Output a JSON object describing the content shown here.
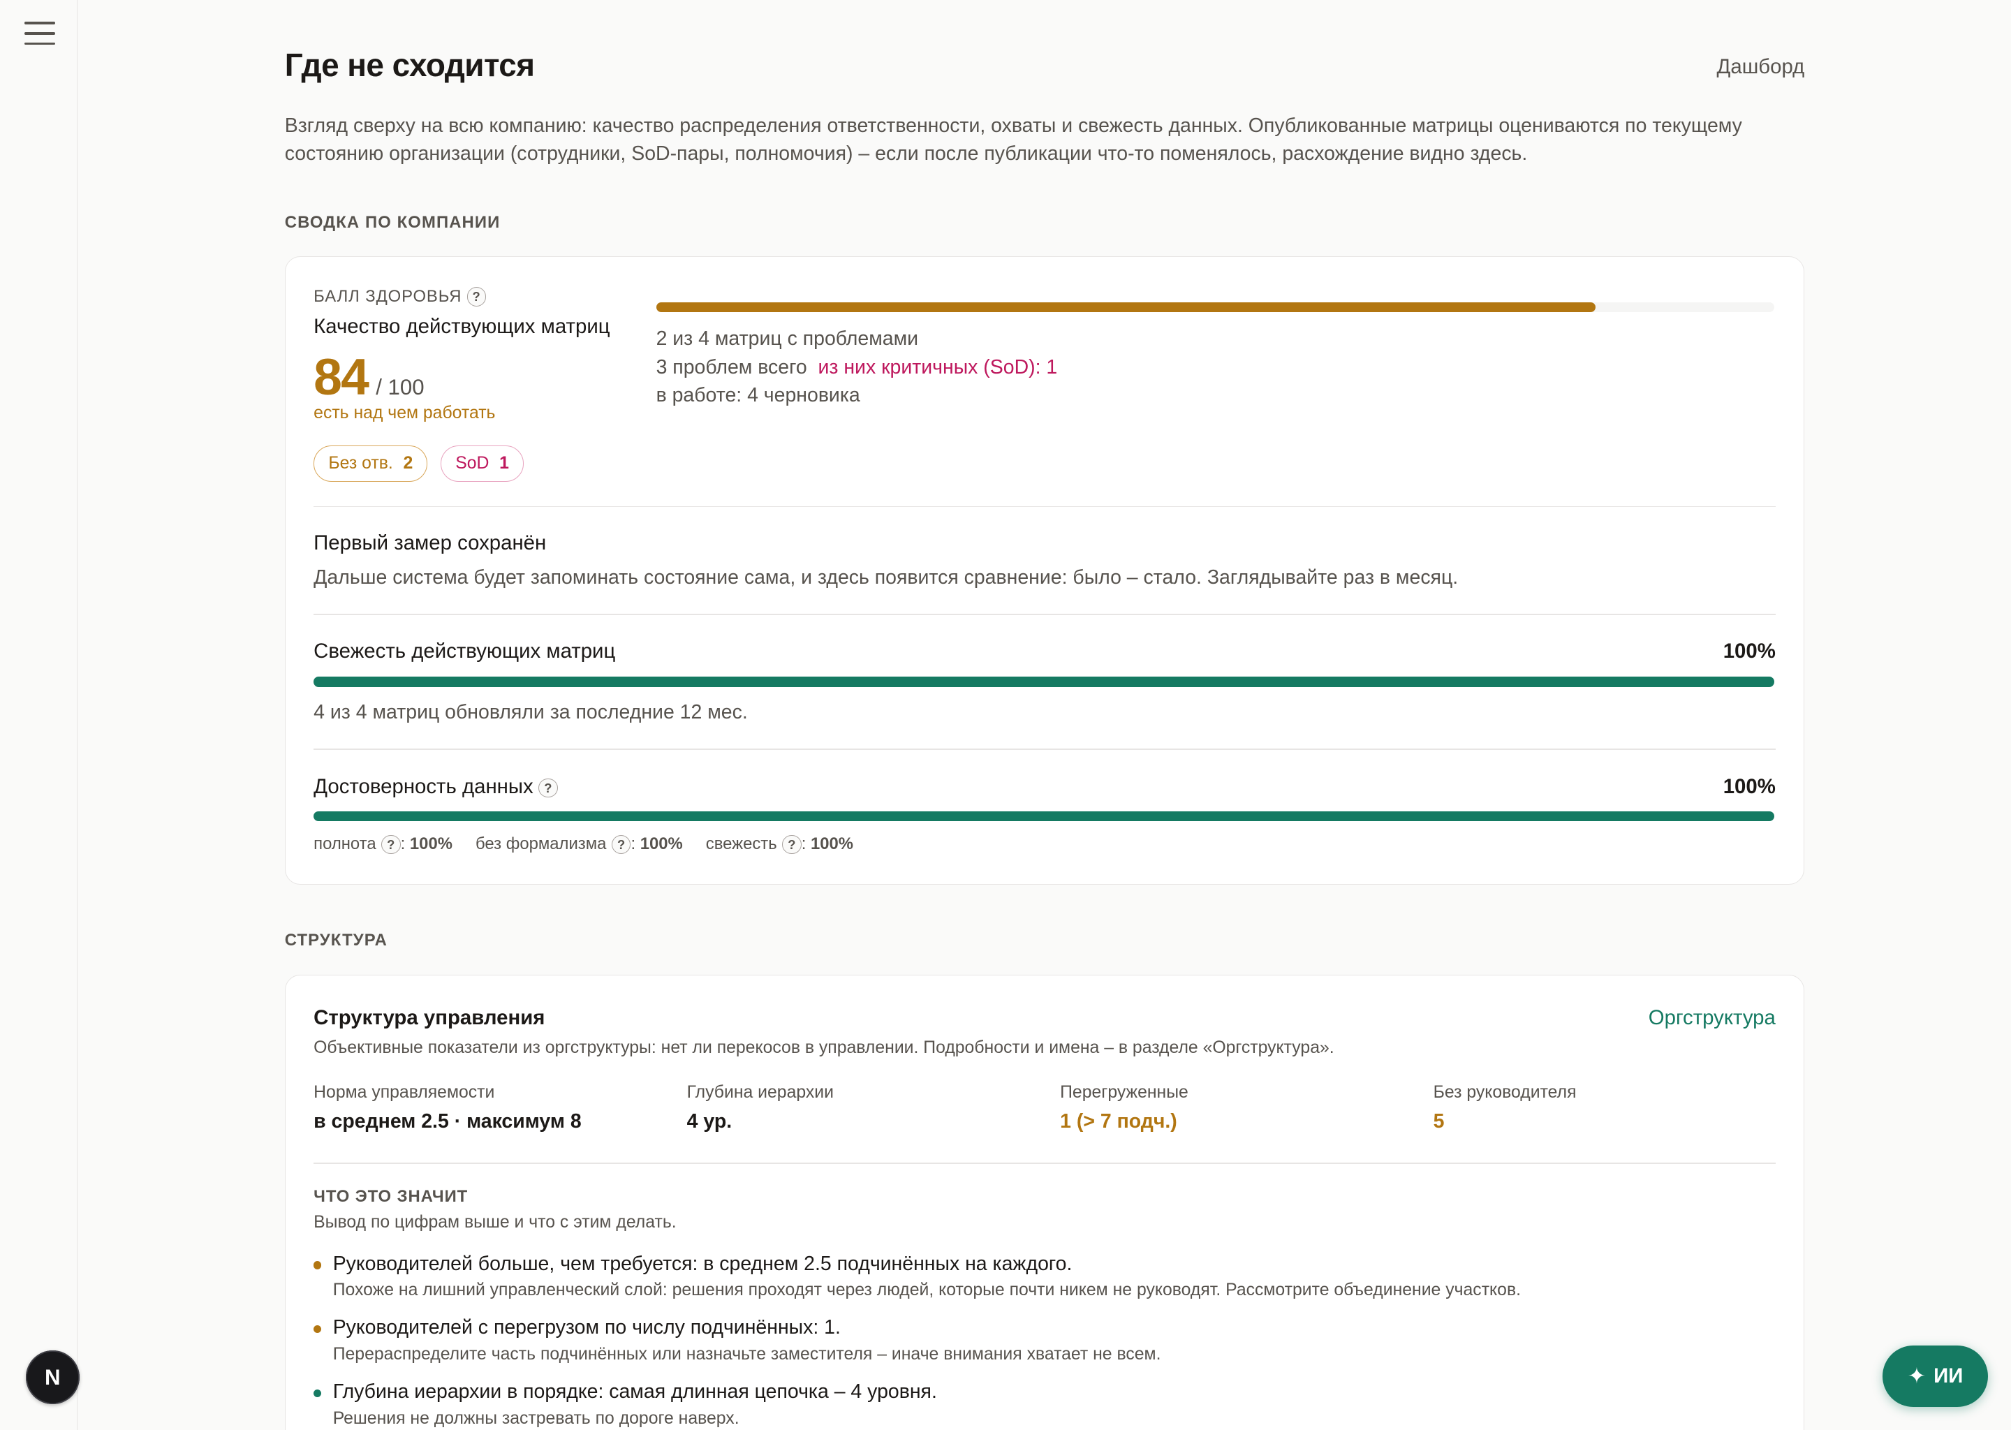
{
  "colors": {
    "accent_gold": "#b27611",
    "critical": "#be185d",
    "good": "#157a62",
    "muted": "#57534e"
  },
  "header": {
    "title": "Где не сходится",
    "dashboard_link": "Дашборд",
    "intro": "Взгляд сверху на всю компанию: качество распределения ответственности, охваты и свежесть данных. Опубликованные матрицы оцениваются по текущему состоянию организации (сотрудники, SoD-пары, полномочия) – если после публикации что-то поменялось, расхождение видно здесь."
  },
  "summary": {
    "section_label": "СВОДКА ПО КОМПАНИИ",
    "health": {
      "label": "БАЛЛ ЗДОРОВЬЯ",
      "hint": "?",
      "subtitle": "Качество действующих матриц",
      "score": "84",
      "score_max": "/ 100",
      "verdict": "есть над чем работать",
      "progress": 0.84,
      "line1": "2 из 4 матриц с проблемами",
      "line2_prefix": "3 проблем всего",
      "line2_critical": "из них критичных (SoD): 1",
      "line3": "в работе: 4 черновика",
      "chips": [
        {
          "label": "Без отв.",
          "count": "2"
        },
        {
          "label": "SoD",
          "count": "1"
        }
      ]
    },
    "first_measure": {
      "title": "Первый замер сохранён",
      "text": "Дальше система будет запоминать состояние сама, и здесь появится сравнение: было – стало. Заглядывайте раз в месяц."
    },
    "freshness": {
      "title": "Свежесть действующих матриц",
      "value": "100%",
      "progress": 1.0,
      "note": "4 из 4 матриц обновляли за последние 12 мес."
    },
    "reliability": {
      "title": "Достоверность данных",
      "hint": "?",
      "value": "100%",
      "progress": 1.0,
      "sub": [
        {
          "label": "полнота",
          "value": "100%"
        },
        {
          "label": "без формализма",
          "value": "100%"
        },
        {
          "label": "свежесть",
          "value": "100%"
        }
      ]
    }
  },
  "structure": {
    "section_label": "СТРУКТУРА",
    "title": "Структура управления",
    "link": "Оргструктура",
    "desc": "Объективные показатели из оргструктуры: нет ли перекосов в управлении. Подробности и имена – в разделе «Оргструктура».",
    "metrics": [
      {
        "label": "Норма управляемости",
        "value": "в среднем 2.5 · максимум 8"
      },
      {
        "label": "Глубина иерархии",
        "value": "4 ур."
      },
      {
        "label": "Перегруженные",
        "value": "1 (> 7 подч.)"
      },
      {
        "label": "Без руководителя",
        "value": "5"
      }
    ],
    "meaning_label": "ЧТО ЭТО ЗНАЧИТ",
    "meaning_sub": "Вывод по цифрам выше и что с этим делать.",
    "findings": [
      {
        "title": "Руководителей больше, чем требуется: в среднем 2.5 подчинённых на каждого.",
        "text": "Похоже на лишний управленческий слой: решения проходят через людей, которые почти никем не руководят. Рассмотрите объединение участков."
      },
      {
        "title": "Руководителей с перегрузом по числу подчинённых: 1.",
        "text": "Перераспределите часть подчинённых или назначьте заместителя – иначе внимания хватает не всем."
      },
      {
        "title": "Глубина иерархии в порядке: самая длинная цепочка – 4 уровня.",
        "text": "Решения не должны застревать по дороге наверх."
      }
    ]
  },
  "rail": {
    "badge": "N"
  },
  "ai_button": {
    "icon": "sparkle-icon",
    "label": "ИИ"
  }
}
